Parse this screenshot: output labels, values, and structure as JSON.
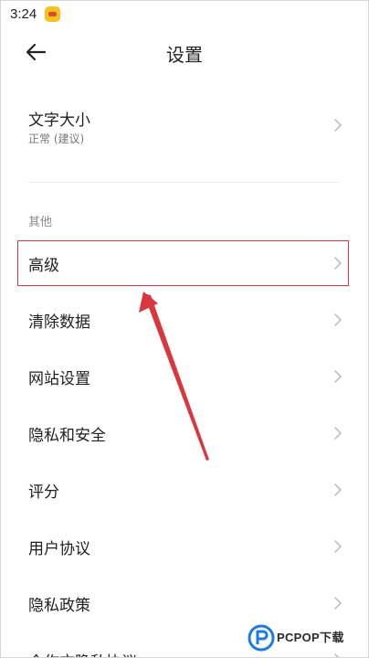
{
  "status_bar": {
    "time": "3:24",
    "app_icon": "app-notification-icon"
  },
  "header": {
    "back_icon": "arrow-left-icon",
    "title": "设置"
  },
  "text_size": {
    "label": "文字大小",
    "value": "正常 (建议)"
  },
  "section": {
    "label": "其他"
  },
  "items": [
    {
      "label": "高级",
      "highlighted": true
    },
    {
      "label": "清除数据"
    },
    {
      "label": "网站设置"
    },
    {
      "label": "隐私和安全"
    },
    {
      "label": "评分"
    },
    {
      "label": "用户协议"
    },
    {
      "label": "隐私政策"
    },
    {
      "label": "合作方隐私协议"
    }
  ],
  "annotation": {
    "color": "#d9363e",
    "icon": "red-arrow-annotation"
  },
  "watermark": {
    "text": "PCPOP下载",
    "icon": "pcpop-logo-icon"
  }
}
